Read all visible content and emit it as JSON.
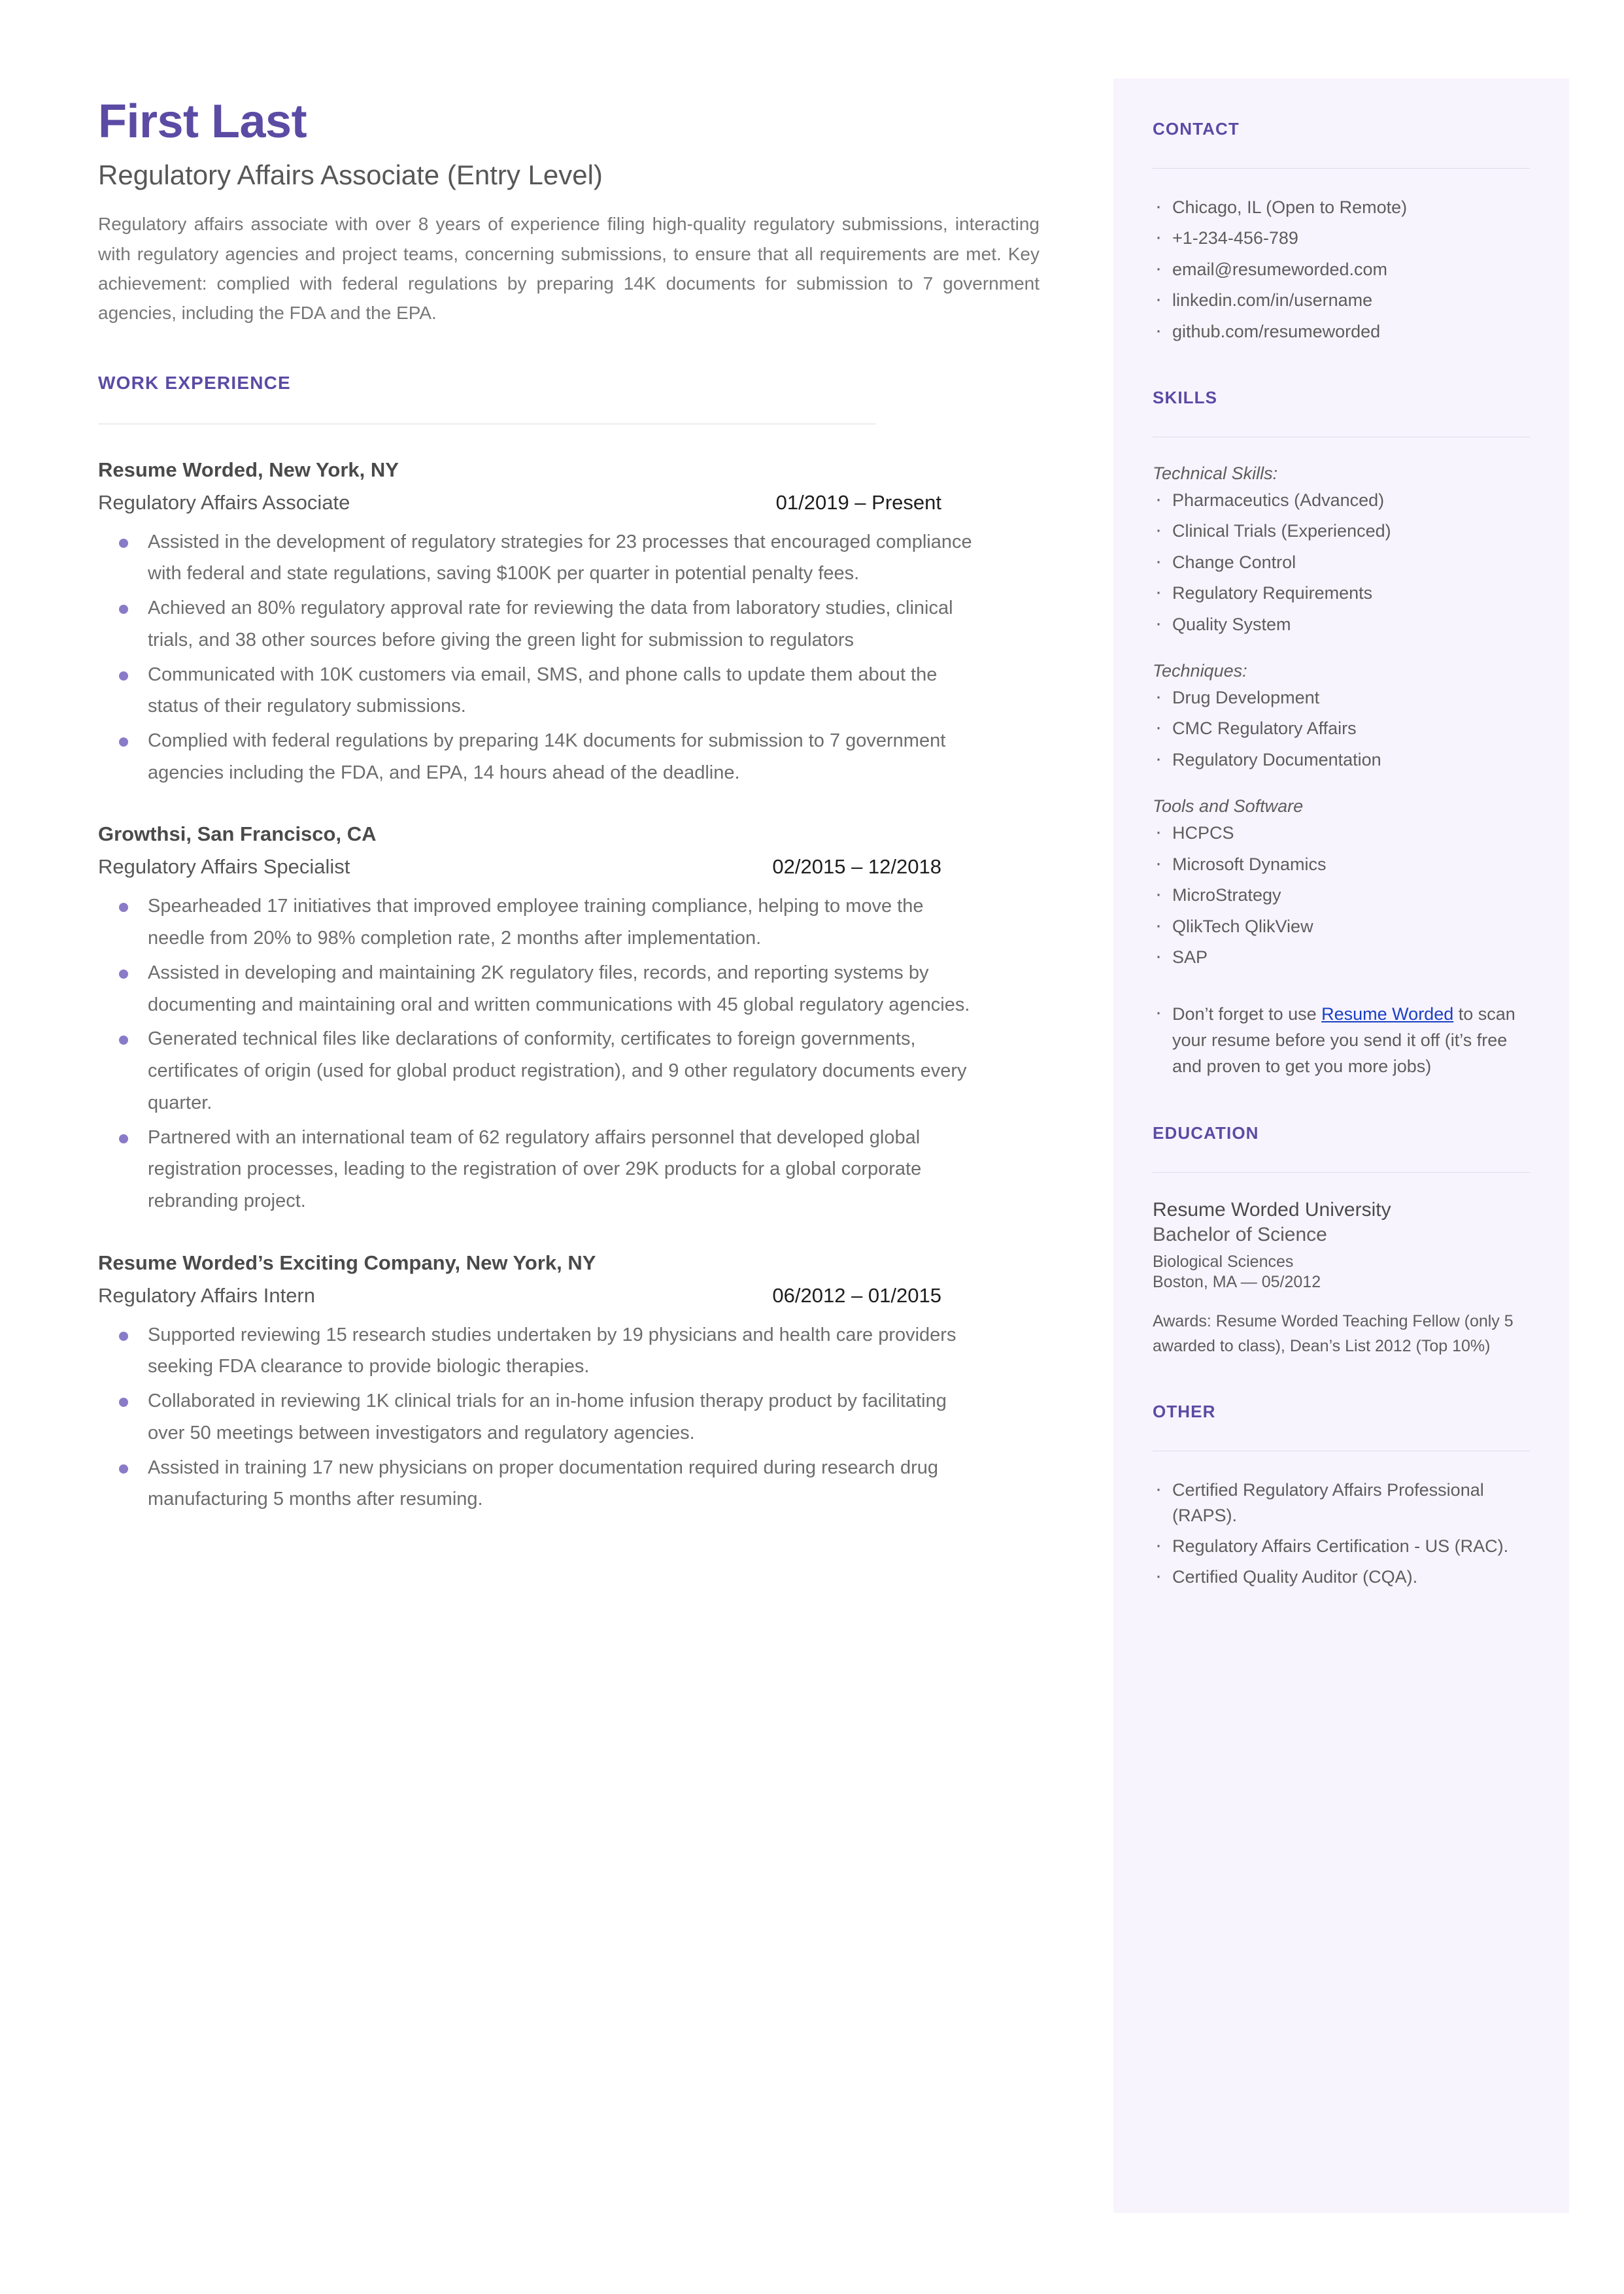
{
  "theme": {
    "accent_purple": "#5b4ba4",
    "bullet_purple": "#8a7bc8",
    "sidebar_bg": "#f8f4fe",
    "link_blue": "#1a3fc4",
    "body_gray": "#6d6d6d"
  },
  "header": {
    "name": "First Last",
    "title": "Regulatory Affairs Associate (Entry Level)",
    "summary": "Regulatory affairs associate with over 8 years of experience filing high-quality regulatory submissions, interacting with regulatory agencies and project teams, concerning submissions, to ensure that all requirements are met. Key achievement: complied with federal regulations by preparing 14K documents for submission to 7 government agencies, including the FDA and the EPA."
  },
  "work_experience": {
    "heading": "WORK EXPERIENCE",
    "jobs": [
      {
        "company": "Resume Worded, New York, NY",
        "role": "Regulatory Affairs Associate",
        "dates": "01/2019 – Present",
        "bullets": [
          "Assisted in the development of regulatory strategies for 23 processes that encouraged compliance with federal and state regulations, saving $100K per quarter in potential penalty fees.",
          "Achieved an 80% regulatory approval rate for reviewing the data from laboratory studies, clinical trials, and 38 other sources before giving the green light for submission to regulators",
          "Communicated with 10K customers via email, SMS, and phone calls to update them about the status of their regulatory submissions.",
          "Complied with federal regulations by preparing 14K documents for submission to 7 government agencies including the FDA, and EPA, 14 hours ahead of the deadline."
        ]
      },
      {
        "company": "Growthsi, San Francisco, CA",
        "role": "Regulatory Affairs Specialist",
        "dates": "02/2015 – 12/2018",
        "bullets": [
          "Spearheaded 17 initiatives that improved employee training compliance, helping to move the needle from 20% to 98% completion rate, 2 months after implementation.",
          "Assisted in developing and maintaining 2K regulatory files, records, and reporting systems by documenting and maintaining oral and written communications with 45 global regulatory agencies.",
          "Generated technical files like declarations of conformity, certificates to foreign governments, certificates of origin (used for global product registration), and 9 other regulatory documents every quarter.",
          "Partnered with an international team of 62 regulatory affairs personnel that developed global registration processes, leading to the registration of over 29K products for a global corporate rebranding project."
        ]
      },
      {
        "company": "Resume Worded’s Exciting Company, New York, NY",
        "role": "Regulatory Affairs Intern",
        "dates": "06/2012 – 01/2015",
        "bullets": [
          "Supported reviewing 15 research studies undertaken by 19 physicians and health care providers seeking FDA clearance to provide biologic therapies.",
          "Collaborated in reviewing 1K clinical trials for an in-home infusion therapy product by facilitating over 50 meetings between investigators and regulatory agencies.",
          "Assisted in training 17 new physicians on proper documentation required during research drug manufacturing 5 months after resuming."
        ]
      }
    ]
  },
  "sidebar": {
    "contact": {
      "heading": "CONTACT",
      "items": [
        "Chicago, IL (Open to Remote)",
        "+1-234-456-789",
        "email@resumeworded.com",
        "linkedin.com/in/username",
        "github.com/resumeworded"
      ]
    },
    "skills": {
      "heading": "SKILLS",
      "groups": [
        {
          "label": "Technical Skills:",
          "items": [
            "Pharmaceutics (Advanced)",
            "Clinical Trials (Experienced)",
            "Change Control",
            "Regulatory Requirements",
            "Quality System"
          ]
        },
        {
          "label": "Techniques:",
          "items": [
            "Drug Development",
            "CMC Regulatory Affairs",
            "Regulatory Documentation"
          ]
        },
        {
          "label": "Tools and Software",
          "items": [
            "HCPCS",
            "Microsoft Dynamics",
            "MicroStrategy",
            "QlikTech QlikView",
            "SAP"
          ]
        }
      ],
      "promo": {
        "before": "Don’t forget to use ",
        "link": "Resume Worded",
        "after": " to scan your resume before you send it off (it’s free and proven to get you more jobs)"
      }
    },
    "education": {
      "heading": "EDUCATION",
      "school": "Resume Worded University",
      "degree": "Bachelor of Science",
      "field": "Biological Sciences",
      "location_date": "Boston, MA — 05/2012",
      "awards": "Awards: Resume Worded Teaching Fellow (only 5 awarded to class), Dean’s List 2012 (Top 10%)"
    },
    "other": {
      "heading": "OTHER",
      "items": [
        "Certified Regulatory Affairs Professional (RAPS).",
        "Regulatory Affairs Certification - US (RAC).",
        "Certified Quality Auditor (CQA)."
      ]
    }
  }
}
